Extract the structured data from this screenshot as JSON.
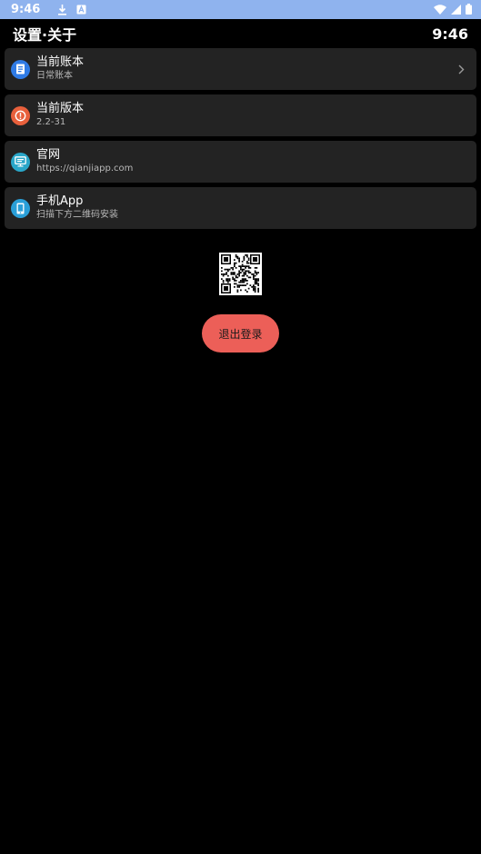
{
  "status_bar": {
    "time": "9:46",
    "icons": [
      "download-icon",
      "a-notification-icon",
      "wifi-icon",
      "signal-icon",
      "battery-icon"
    ]
  },
  "header": {
    "title": "设置·关于",
    "clock": "9:46"
  },
  "items": [
    {
      "title": "当前账本",
      "subtitle": "日常账本",
      "icon": "ledger-icon",
      "icon_color": "#2f7be6",
      "has_chevron": true
    },
    {
      "title": "当前版本",
      "subtitle": "2.2-31",
      "icon": "info-icon",
      "icon_color": "#e8603c",
      "has_chevron": false
    },
    {
      "title": "官网",
      "subtitle": "https://qianjiapp.com",
      "icon": "monitor-icon",
      "icon_color": "#2aa7c9",
      "has_chevron": false
    },
    {
      "title": "手机App",
      "subtitle": "扫描下方二维码安装",
      "icon": "phone-icon",
      "icon_color": "#2a9fd8",
      "has_chevron": false
    }
  ],
  "qr": {
    "icon": "qr-code-icon"
  },
  "logout": {
    "label": "退出登录",
    "color": "#ec5f58"
  }
}
